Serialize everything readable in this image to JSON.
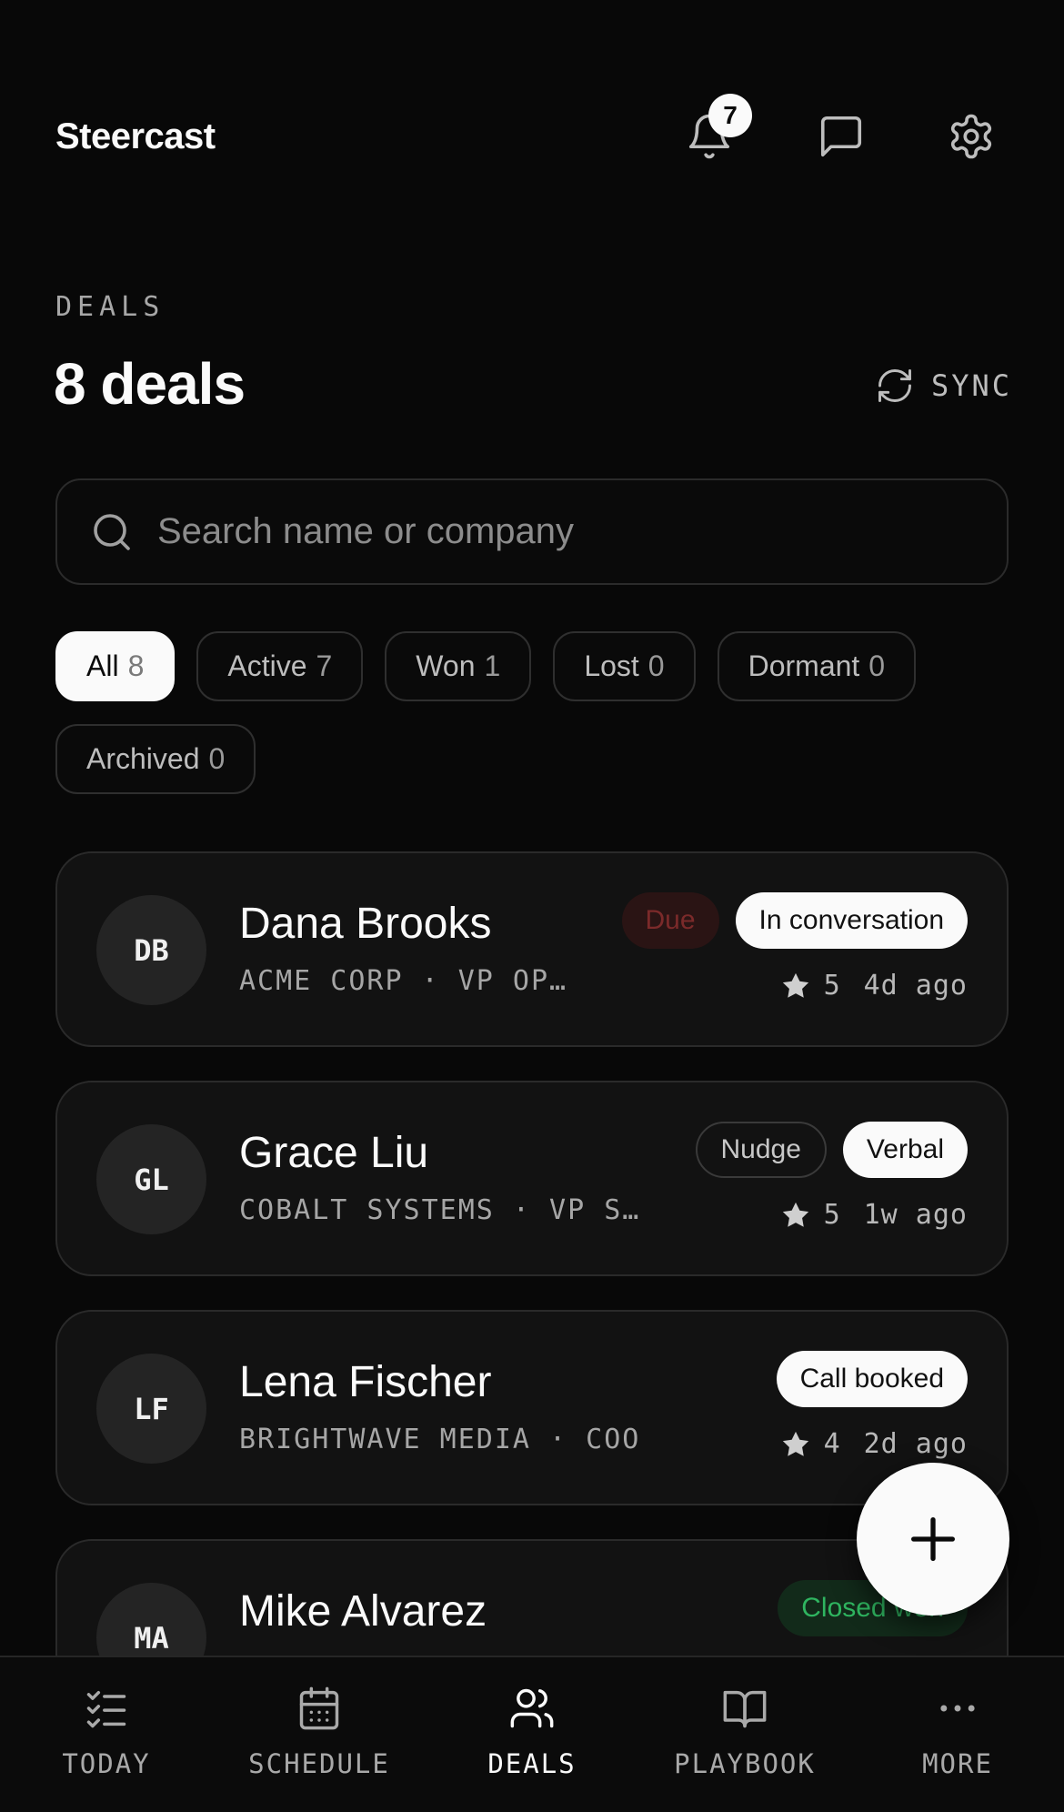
{
  "app": {
    "name": "Steercast"
  },
  "header": {
    "notification_count": "7"
  },
  "page": {
    "section_label": "DEALS",
    "title": "8 deals",
    "sync_label": "SYNC"
  },
  "search": {
    "placeholder": "Search name or company",
    "value": ""
  },
  "filters": [
    {
      "label": "All",
      "count": "8",
      "active": true
    },
    {
      "label": "Active",
      "count": "7",
      "active": false
    },
    {
      "label": "Won",
      "count": "1",
      "active": false
    },
    {
      "label": "Lost",
      "count": "0",
      "active": false
    },
    {
      "label": "Dormant",
      "count": "0",
      "active": false
    },
    {
      "label": "Archived",
      "count": "0",
      "active": false
    }
  ],
  "deals": [
    {
      "initials": "DB",
      "name": "Dana Brooks",
      "subtitle": "ACME CORP · VP OPE…",
      "tags": [
        {
          "label": "Due",
          "style": "due"
        },
        {
          "label": "In conversation",
          "style": "white"
        }
      ],
      "rating": "5",
      "age": "4d ago"
    },
    {
      "initials": "GL",
      "name": "Grace Liu",
      "subtitle": "COBALT SYSTEMS · VP SA…",
      "tags": [
        {
          "label": "Nudge",
          "style": "outline"
        },
        {
          "label": "Verbal",
          "style": "white"
        }
      ],
      "rating": "5",
      "age": "1w ago"
    },
    {
      "initials": "LF",
      "name": "Lena Fischer",
      "subtitle": "BRIGHTWAVE MEDIA · COO",
      "tags": [
        {
          "label": "Call booked",
          "style": "white"
        }
      ],
      "rating": "4",
      "age": "2d ago"
    },
    {
      "initials": "MA",
      "name": "Mike Alvarez",
      "subtitle": "",
      "tags": [
        {
          "label": "Closed won",
          "style": "won"
        }
      ],
      "rating": "",
      "age": ""
    }
  ],
  "tabbar": [
    {
      "label": "TODAY",
      "icon": "checklist-icon",
      "current": false
    },
    {
      "label": "SCHEDULE",
      "icon": "calendar-icon",
      "current": false
    },
    {
      "label": "DEALS",
      "icon": "users-icon",
      "current": true
    },
    {
      "label": "PLAYBOOK",
      "icon": "book-icon",
      "current": false
    },
    {
      "label": "MORE",
      "icon": "more-icon",
      "current": false
    }
  ],
  "colors": {
    "background": "#080808",
    "card": "#121212",
    "accent": "#fafafa",
    "due": "#7b2a2a",
    "won": "#2fb560"
  }
}
